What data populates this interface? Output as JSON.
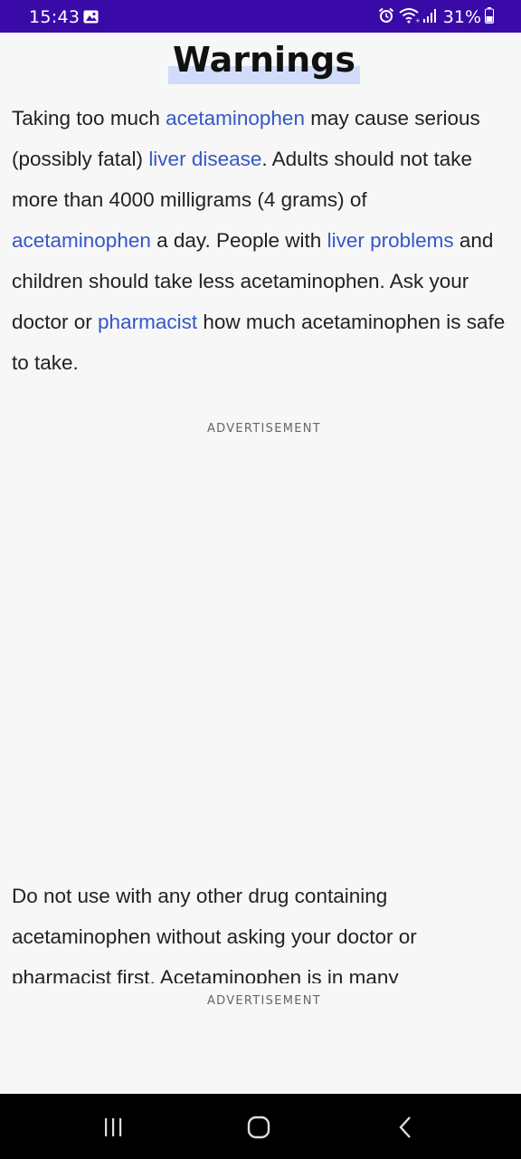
{
  "status_bar": {
    "time": "15:43",
    "battery_percent": "31%",
    "icons": [
      "gallery-icon",
      "alarm-icon",
      "wifi-icon",
      "signal-icon",
      "battery-icon"
    ],
    "background_color": "#3a0aa8"
  },
  "article": {
    "heading": "Warnings",
    "paragraph1": {
      "t1": "Taking too much ",
      "l1": "acetaminophen",
      "t2": " may cause serious (possibly fatal) ",
      "l2": "liver disease",
      "t3": ". Adults should not take more than 4000 milligrams (4 grams) of ",
      "l3": "acetaminophen",
      "t4": " a day. People with ",
      "l4": "liver problems",
      "t5": " and children should take less acetaminophen. Ask your doctor or ",
      "l5": "pharmacist",
      "t6": " how much acetaminophen is safe to take."
    },
    "paragraph2": "Do not use with any other drug containing acetaminophen without asking your doctor or pharmacist first. Acetaminophen is in many",
    "link_color": "#3557c7",
    "highlight_color": "#d1dcfb"
  },
  "ads": {
    "label_1": "ADVERTISEMENT",
    "label_2": "ADVERTISEMENT"
  },
  "nav_bar": {
    "buttons": [
      "recents-icon",
      "home-icon",
      "back-icon"
    ]
  }
}
